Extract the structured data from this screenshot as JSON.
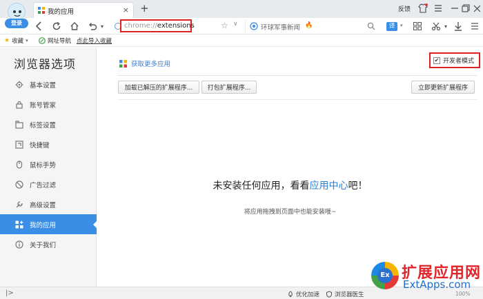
{
  "browser": {
    "login_label": "登录",
    "tab": {
      "title": "我的应用",
      "close": "×"
    },
    "new_tab": "+",
    "feedback": "反馈",
    "address": {
      "scheme": "chrome://",
      "path": "extensions"
    },
    "search": {
      "text": "环球军事新闻",
      "translate": "译"
    },
    "bookmarks": [
      {
        "label": "收藏",
        "icon": "star-icon"
      },
      {
        "label": "网址导航",
        "icon": "nav-icon"
      },
      {
        "label": "点此导入收藏",
        "icon": ""
      }
    ]
  },
  "sidebar": {
    "title": "浏览器选项",
    "items": [
      {
        "label": "基本设置",
        "icon": "gear-icon",
        "active": false
      },
      {
        "label": "账号管家",
        "icon": "lock-icon",
        "active": false
      },
      {
        "label": "标签设置",
        "icon": "tabs-icon",
        "active": false
      },
      {
        "label": "快捷键",
        "icon": "keyboard-icon",
        "active": false
      },
      {
        "label": "鼠标手势",
        "icon": "mouse-icon",
        "active": false
      },
      {
        "label": "广告过滤",
        "icon": "block-icon",
        "active": false
      },
      {
        "label": "高级设置",
        "icon": "wrench-icon",
        "active": false
      },
      {
        "label": "我的应用",
        "icon": "apps-icon",
        "active": true
      },
      {
        "label": "关于我们",
        "icon": "info-icon",
        "active": false
      }
    ]
  },
  "main": {
    "more_apps": "获取更多应用",
    "dev_mode": {
      "label": "开发者模式",
      "checked": true,
      "check_mark": "✔"
    },
    "buttons": {
      "load_unpacked": "加载已解压的扩展程序...",
      "pack": "打包扩展程序...",
      "update": "立即更新扩展程序"
    },
    "empty": {
      "prefix": "未安装任何应用，看看",
      "link": "应用中心",
      "suffix": "吧！",
      "hint": "将应用拖拽到页面中也能安装哦~"
    }
  },
  "statusbar": {
    "toggle": "|>",
    "items": [
      "优化加速",
      "浏览器医生"
    ],
    "zoom": "100%"
  },
  "watermark": {
    "title": "扩展应用网",
    "subtitle": "ExtApps.com",
    "logo_text": "Ex"
  },
  "colors": {
    "accent": "#3a8ee6",
    "highlight_box": "#e02020",
    "link": "#2d7fd8"
  }
}
